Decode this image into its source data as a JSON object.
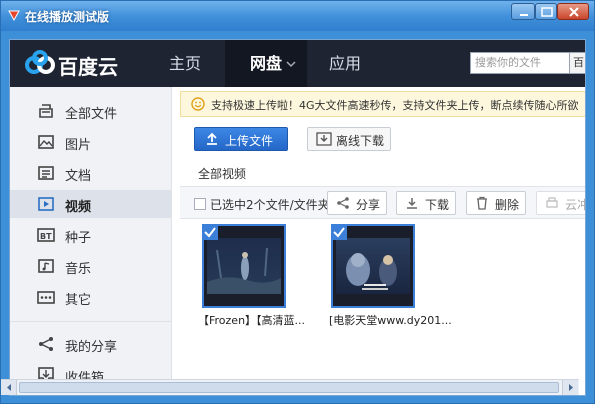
{
  "window": {
    "title": "在线播放测试版",
    "buttons": [
      "minimize",
      "maximize",
      "close"
    ]
  },
  "brand": {
    "logo_text": "百度云",
    "logo_icon": "baidu-cloud-icon"
  },
  "nav": {
    "home": "主页",
    "disk": "网盘",
    "apps": "应用",
    "search_placeholder": "搜索你的文件",
    "search_button": "百"
  },
  "sidebar": {
    "items": [
      {
        "label": "全部文件",
        "icon": "file-stack-icon",
        "active": false
      },
      {
        "label": "图片",
        "icon": "image-icon",
        "active": false
      },
      {
        "label": "文档",
        "icon": "document-icon",
        "active": false
      },
      {
        "label": "视频",
        "icon": "video-icon",
        "active": true
      },
      {
        "label": "种子",
        "icon": "torrent-icon",
        "active": false
      },
      {
        "label": "音乐",
        "icon": "music-icon",
        "active": false
      },
      {
        "label": "其它",
        "icon": "more-icon",
        "active": false
      },
      {
        "label": "我的分享",
        "icon": "share-icon",
        "active": false
      },
      {
        "label": "收件箱",
        "icon": "inbox-icon",
        "active": false
      }
    ]
  },
  "notice": {
    "text": "支持极速上传啦！4G大文件高速秒传，支持文件夹上传，断点续传随心所欲",
    "trailing": "!"
  },
  "actions": {
    "upload": "上传文件",
    "offline": "离线下载"
  },
  "breadcrumb": "全部视频",
  "toolbar": {
    "selection": "已选中2个文件/文件夹",
    "share": "分享",
    "download": "下载",
    "delete": "删除",
    "cloud": "云冲"
  },
  "files": [
    {
      "caption": "【Frozen】【高清蓝...",
      "selected": true
    },
    {
      "caption": "[电影天堂www.dy201...",
      "selected": true
    }
  ],
  "colors": {
    "accent": "#3b7fd8",
    "nav_bg": "#1e2432",
    "title_bar": "#3e8ed9"
  }
}
